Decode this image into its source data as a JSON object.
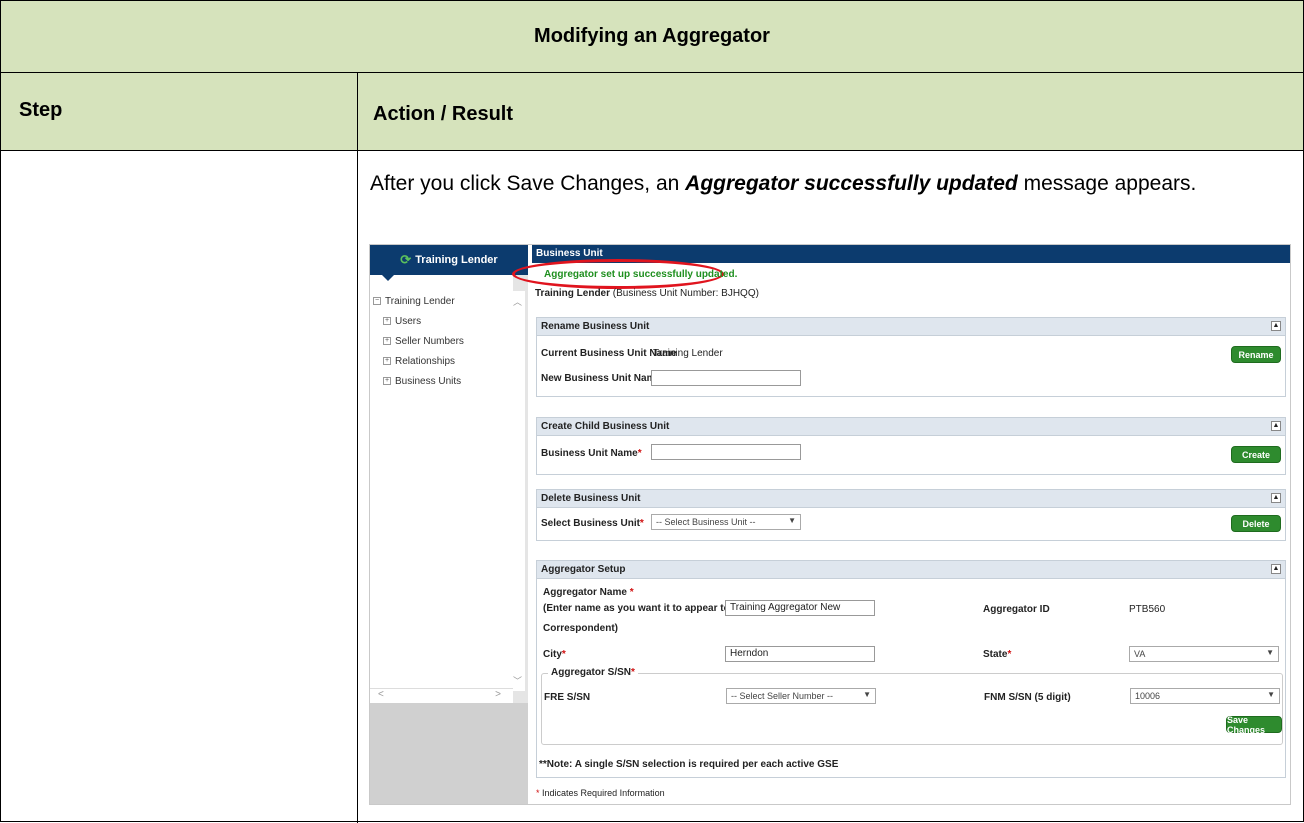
{
  "title": "Modifying an Aggregator",
  "headers": {
    "step": "Step",
    "action": "Action / Result"
  },
  "instruction": {
    "before": "After you click Save Changes, an ",
    "emphasis": "Aggregator successfully updated",
    "after": " message appears."
  },
  "screenshot": {
    "sidebar": {
      "title": "Training Lender",
      "tree": [
        {
          "label": "Training Lender",
          "level": 0
        },
        {
          "label": "Users",
          "level": 1
        },
        {
          "label": "Seller Numbers",
          "level": 1
        },
        {
          "label": "Relationships",
          "level": 1
        },
        {
          "label": "Business Units",
          "level": 1
        }
      ]
    },
    "main_header": "Business Unit",
    "success_message": "Aggregator set up successfully updated.",
    "unit_name": "Training Lender",
    "unit_number": "(Business Unit Number: BJHQQ)",
    "rename_panel": {
      "title": "Rename Business Unit",
      "current_label": "Current Business Unit Name",
      "current_value": "Training Lender",
      "new_label": "New Business Unit Name",
      "new_value": "",
      "button": "Rename"
    },
    "create_panel": {
      "title": "Create Child Business Unit",
      "name_label": "Business Unit Name",
      "name_value": "",
      "button": "Create"
    },
    "delete_panel": {
      "title": "Delete Business Unit",
      "select_label": "Select Business Unit",
      "select_value": "-- Select Business Unit --",
      "button": "Delete"
    },
    "aggregator_panel": {
      "title": "Aggregator Setup",
      "name_label": "Aggregator Name",
      "name_hint_1": "(Enter name as you want it to appear to your",
      "name_hint_2": "Correspondent)",
      "name_value": "Training Aggregator New",
      "id_label": "Aggregator ID",
      "id_value": "PTB560",
      "city_label": "City",
      "city_value": "Herndon",
      "state_label": "State",
      "state_value": "VA",
      "sssn_legend": "Aggregator S/SN",
      "fre_label": "FRE S/SN",
      "fre_value": "-- Select Seller Number --",
      "fnm_label": "FNM S/SN (5 digit)",
      "fnm_value": "10006",
      "save_button": "Save Changes",
      "note": "**Note: A single S/SN selection is required per each active GSE"
    },
    "required_note": "Indicates Required Information",
    "required_mark": "*"
  }
}
